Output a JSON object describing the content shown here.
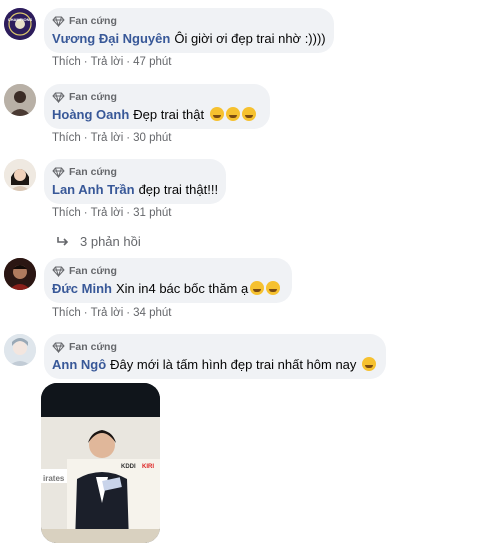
{
  "comments": [
    {
      "badge": "Fan cứng",
      "author": "Vương Đại Nguyên",
      "text": "Ôi giời ơi đẹp trai nhờ :))))",
      "like": "Thích",
      "reply": "Trả lời",
      "time": "47 phút",
      "emoji_count": 0
    },
    {
      "badge": "Fan cứng",
      "author": "Hoàng Oanh",
      "text": "Đẹp trai thật",
      "like": "Thích",
      "reply": "Trả lời",
      "time": "30 phút",
      "emoji_count": 3
    },
    {
      "badge": "Fan cứng",
      "author": "Lan Anh Trần",
      "text": "đẹp trai thật!!!",
      "like": "Thích",
      "reply": "Trả lời",
      "time": "31 phút",
      "emoji_count": 0
    },
    {
      "badge": "Fan cứng",
      "author": "Đức Minh",
      "text": "Xin in4 bác bốc thăm ạ",
      "like": "Thích",
      "reply": "Trả lời",
      "time": "34 phút",
      "emoji_count": 2
    },
    {
      "badge": "Fan cứng",
      "author": "Ann Ngô",
      "text": "Đây mới là tấm hình đẹp trai nhất hôm nay",
      "emoji_count": 1
    }
  ],
  "replies": {
    "label": "3 phản hồi"
  },
  "avatar_texts": {
    "first": "CHAMPIONS"
  },
  "photo_texts": {
    "left": "irates",
    "kddi": "KDDI",
    "kirin": "KIRI"
  },
  "colors": {
    "author": "#385898",
    "meta": "#65676b",
    "bubble": "#f0f2f5"
  }
}
